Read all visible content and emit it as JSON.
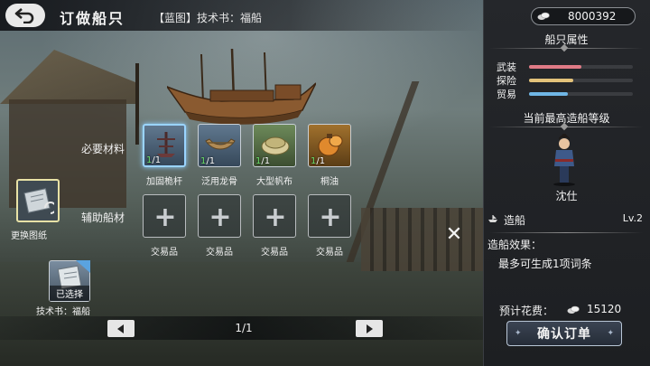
{
  "header": {
    "title": "订做船只",
    "subtitle": "【蓝图】技术书：福船"
  },
  "materials": {
    "required_label": "必要材料",
    "required": [
      {
        "name": "加固桅杆",
        "have": "1",
        "need": "/1",
        "icon": "mast-icon",
        "tint": "blue",
        "selected": true
      },
      {
        "name": "泛用龙骨",
        "have": "1",
        "need": "/1",
        "icon": "keel-icon",
        "tint": "blue",
        "selected": false
      },
      {
        "name": "大型帆布",
        "have": "1",
        "need": "/1",
        "icon": "canvas-icon",
        "tint": "green",
        "selected": false
      },
      {
        "name": "桐油",
        "have": "1",
        "need": "/1",
        "icon": "oil-icon",
        "tint": "orange",
        "selected": false
      }
    ],
    "auxiliary_label": "辅助船材",
    "auxiliary": [
      {
        "name": "交易品"
      },
      {
        "name": "交易品"
      },
      {
        "name": "交易品"
      },
      {
        "name": "交易品"
      }
    ]
  },
  "blueprint": {
    "change_label": "更换图纸",
    "selected_tag": "已选择",
    "selected_name": "技术书：福船"
  },
  "pager": {
    "text": "1/1"
  },
  "panel": {
    "coins": "8000392",
    "ship_attr_title": "船只属性",
    "attributes": [
      {
        "label": "武装",
        "value": 0.5,
        "color": "#e07b86"
      },
      {
        "label": "探险",
        "value": 0.43,
        "color": "#e3c27a"
      },
      {
        "label": "贸易",
        "value": 0.37,
        "color": "#6fb6e6"
      }
    ],
    "level_title": "当前最高造船等级",
    "npc_name": "沈仕",
    "skill_name": "造船",
    "skill_level": "Lv.2",
    "effect_title": "造船效果：",
    "effect_text": "最多可生成1项词条",
    "cost_label": "预计花费：",
    "cost_value": "15120",
    "confirm_label": "确认订单"
  }
}
